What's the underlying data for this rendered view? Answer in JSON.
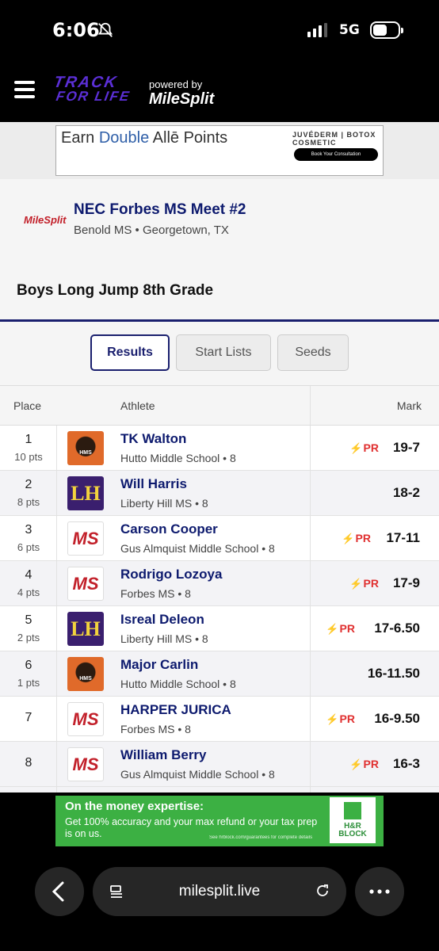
{
  "status": {
    "time": "6:06",
    "network": "5G"
  },
  "nav": {
    "logo_line1": "TRACK",
    "logo_line2": "FOR LIFE",
    "powered_by": "powered by",
    "brand": "MileSplit"
  },
  "ad_top": {
    "headline_prefix": "Earn ",
    "headline_bold": "Double",
    "headline_rest": " Allē Points",
    "brand": "JUVÉDERM | BOTOX COSMETIC",
    "button": "Book Your Consultation"
  },
  "meet": {
    "logo_text": "MileSplit",
    "title": "NEC Forbes MS Meet #2",
    "location": "Benold MS • Georgetown, TX",
    "event": "Boys Long Jump 8th Grade"
  },
  "tabs": [
    {
      "label": "Results",
      "active": true
    },
    {
      "label": "Start Lists",
      "active": false
    },
    {
      "label": "Seeds",
      "active": false
    }
  ],
  "table": {
    "headers": {
      "place": "Place",
      "athlete": "Athlete",
      "mark": "Mark"
    },
    "rows": [
      {
        "place": "1",
        "pts": "10 pts",
        "name": "TK Walton",
        "team": "Hutto Middle School • 8",
        "mark": "19-7",
        "pr": "PR",
        "logo": "hutto"
      },
      {
        "place": "2",
        "pts": "8 pts",
        "name": "Will Harris",
        "team": "Liberty Hill MS • 8",
        "mark": "18-2",
        "pr": "",
        "logo": "lh"
      },
      {
        "place": "3",
        "pts": "6 pts",
        "name": "Carson Cooper",
        "team": "Gus Almquist Middle School • 8",
        "mark": "17-11",
        "pr": "PR",
        "logo": "ms"
      },
      {
        "place": "4",
        "pts": "4 pts",
        "name": "Rodrigo Lozoya",
        "team": "Forbes MS • 8",
        "mark": "17-9",
        "pr": "PR",
        "logo": "ms"
      },
      {
        "place": "5",
        "pts": "2 pts",
        "name": "Isreal Deleon",
        "team": "Liberty Hill MS • 8",
        "mark": "17-6.50",
        "pr": "PR",
        "logo": "lh"
      },
      {
        "place": "6",
        "pts": "1 pts",
        "name": "Major Carlin",
        "team": "Hutto Middle School • 8",
        "mark": "16-11.50",
        "pr": "",
        "logo": "hutto"
      },
      {
        "place": "7",
        "pts": "",
        "name": "HARPER JURICA",
        "team": "Forbes MS • 8",
        "mark": "16-9.50",
        "pr": "PR",
        "logo": "ms"
      },
      {
        "place": "8",
        "pts": "",
        "name": "William Berry",
        "team": "Gus Almquist Middle School • 8",
        "mark": "16-3",
        "pr": "PR",
        "logo": "ms"
      }
    ]
  },
  "ad_bottom": {
    "headline": "On the money expertise:",
    "body": "Get 100% accuracy and your max refund or your tax prep is on us.",
    "fine": "See hrblock.com/guarantees for complete details",
    "brand": "H&R BLOCK"
  },
  "browser": {
    "url": "milesplit.live"
  }
}
